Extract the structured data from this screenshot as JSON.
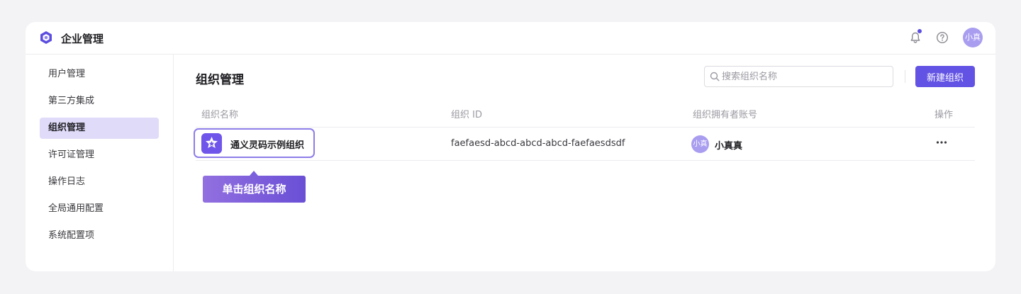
{
  "header": {
    "app_title": "企业管理",
    "avatar_text": "小真"
  },
  "sidebar": {
    "items": [
      {
        "label": "用户管理"
      },
      {
        "label": "第三方集成"
      },
      {
        "label": "组织管理",
        "active": true
      },
      {
        "label": "许可证管理"
      },
      {
        "label": "操作日志"
      },
      {
        "label": "全局通用配置"
      },
      {
        "label": "系统配置项"
      }
    ]
  },
  "main": {
    "title": "组织管理",
    "search": {
      "placeholder": "搜索组织名称",
      "value": ""
    },
    "new_button": "新建组织",
    "table": {
      "columns": [
        "组织名称",
        "组织 ID",
        "组织拥有者账号",
        "操作"
      ],
      "rows": [
        {
          "name": "通义灵码示例组织",
          "id": "faefaesd-abcd-abcd-abcd-faefaesdsdf",
          "owner_avatar": "小真",
          "owner": "小真真"
        }
      ]
    },
    "tooltip": "单击组织名称"
  },
  "colors": {
    "accent": "#6353e4",
    "active_nav_bg": "#dfdbf9",
    "avatar_bg": "#a99df0",
    "highlight_border": "#8d7de8",
    "notification_dot": "#5b4de0"
  },
  "icons": [
    "logo-icon",
    "bell-icon",
    "help-icon",
    "search-icon",
    "org-logo-icon",
    "more-icon"
  ]
}
